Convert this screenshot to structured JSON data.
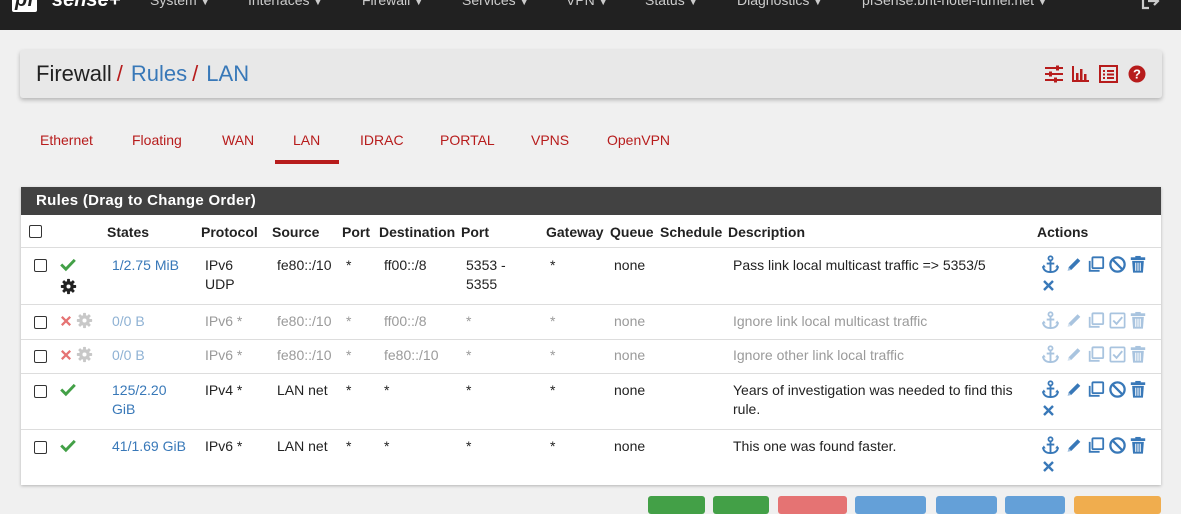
{
  "topnav": {
    "brand": "pf",
    "brand_rest": "sense+",
    "items": [
      "System",
      "Interfaces",
      "Firewall",
      "Services",
      "VPN",
      "Status",
      "Diagnostics",
      "pfSense.brit-hotel-fumel.net"
    ]
  },
  "breadcrumb": {
    "part1": "Firewall",
    "part2": "Rules",
    "part3": "LAN",
    "sep": "/"
  },
  "tabs": [
    "Ethernet",
    "Floating",
    "WAN",
    "LAN",
    "IDRAC",
    "PORTAL",
    "VPNS",
    "OpenVPN"
  ],
  "active_tab": "LAN",
  "panel": {
    "title": "Rules (Drag to Change Order)",
    "columns": {
      "states": "States",
      "protocol": "Protocol",
      "source": "Source",
      "port": "Port",
      "destination": "Destination",
      "port2": "Port",
      "gateway": "Gateway",
      "queue": "Queue",
      "schedule": "Schedule",
      "description": "Description",
      "actions": "Actions"
    }
  },
  "rules": [
    {
      "states": "1/2.75 MiB",
      "protocol_1": "IPv6",
      "protocol_2": "UDP",
      "source": "fe80::/10",
      "port": "*",
      "destination": "ff00::/8",
      "dport_1": "5353 -",
      "dport_2": "5355",
      "gateway": "*",
      "queue": "none",
      "description": "Pass link local multicast traffic => 5353/5",
      "status": "pass",
      "enabled": true
    },
    {
      "states": "0/0 B",
      "protocol": "IPv6 *",
      "source": "fe80::/10",
      "port": "*",
      "destination": "ff00::/8",
      "dport": "*",
      "gateway": "*",
      "queue": "none",
      "description": "Ignore link local multicast traffic",
      "status": "block",
      "enabled": false
    },
    {
      "states": "0/0 B",
      "protocol": "IPv6 *",
      "source": "fe80::/10",
      "port": "*",
      "destination": "fe80::/10",
      "dport": "*",
      "gateway": "*",
      "queue": "none",
      "description": "Ignore other link local traffic",
      "status": "block",
      "enabled": false
    },
    {
      "states_1": "125/2.20",
      "states_2": "GiB",
      "protocol": "IPv4 *",
      "source": "LAN net",
      "port": "*",
      "destination": "*",
      "dport": "*",
      "gateway": "*",
      "queue": "none",
      "description_1": "Years of investigation was needed to find this",
      "description_2": "rule.",
      "status": "pass",
      "enabled": true
    },
    {
      "states": "41/1.69 GiB",
      "protocol": "IPv6 *",
      "source": "LAN net",
      "port": "*",
      "destination": "*",
      "dport": "*",
      "gateway": "*",
      "queue": "none",
      "description": "This one was found faster.",
      "status": "pass",
      "enabled": true
    }
  ],
  "colors": {
    "accent": "#b71c1c",
    "link": "#3878b8",
    "pass": "#43a047",
    "block": "#e57373",
    "header": "#424242"
  },
  "icons": [
    "anchor-icon",
    "pencil-icon",
    "copy-icon",
    "disable-icon",
    "enable-icon",
    "trash-icon",
    "delete-x-icon",
    "gear-icon",
    "check-icon",
    "times-icon",
    "settings-sliders-icon",
    "chart-icon",
    "list-icon",
    "help-icon",
    "logout-icon"
  ],
  "bottom_buttons": [
    "add-top",
    "add-bottom",
    "delete",
    "toggle",
    "copy",
    "save",
    "separator"
  ]
}
